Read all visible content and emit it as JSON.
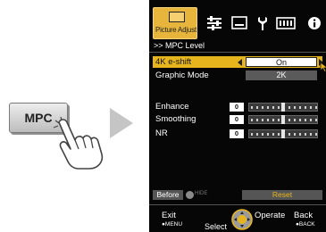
{
  "remote": {
    "button_label": "MPC"
  },
  "osd": {
    "tabs": [
      {
        "label": "Picture Adjust",
        "icon": "picture-icon",
        "active": true
      },
      {
        "icon": "sliders-icon"
      },
      {
        "icon": "display-icon"
      },
      {
        "icon": "wrench-icon"
      },
      {
        "icon": "input-signal-icon"
      },
      {
        "icon": "info-icon"
      }
    ],
    "level_title": ">> MPC Level",
    "rows": {
      "k4_shift_label": "4K e-shift",
      "k4_shift_value": "On",
      "graphic_mode_label": "Graphic Mode",
      "graphic_mode_value": "2K"
    },
    "sliders": [
      {
        "label": "Enhance",
        "value": "0"
      },
      {
        "label": "Smoothing",
        "value": "0"
      },
      {
        "label": "NR",
        "value": "0"
      }
    ],
    "bottom": {
      "before_label": "Before",
      "toggle_label": "HIDE",
      "reset_label": "Reset"
    },
    "footer": {
      "exit": "Exit",
      "exit_sub": "●MENU",
      "select": "Select",
      "operate": "Operate",
      "back": "Back",
      "back_sub": "●BACK"
    }
  },
  "colors": {
    "osd_background": "#060606",
    "highlight": "#e6b51e",
    "active_tab": "#e7b53b"
  }
}
